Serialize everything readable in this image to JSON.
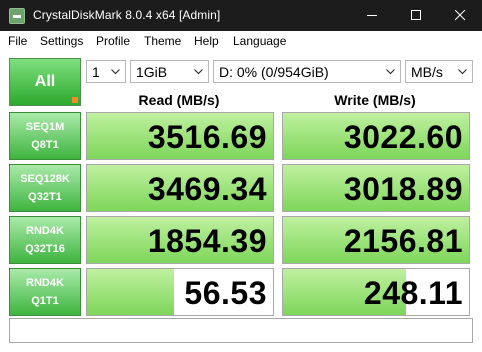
{
  "window": {
    "title": "CrystalDiskMark 8.0.4 x64 [Admin]"
  },
  "menu": [
    "File",
    "Settings",
    "Profile",
    "Theme",
    "Help",
    "Language"
  ],
  "controls": {
    "all_label": "All",
    "count": "1",
    "size": "1GiB",
    "drive": "D: 0% (0/954GiB)",
    "unit": "MB/s"
  },
  "headers": {
    "read": "Read (MB/s)",
    "write": "Write (MB/s)"
  },
  "tests": [
    {
      "line1": "SEQ1M",
      "line2": "Q8T1",
      "read": "3516.69",
      "write": "3022.60",
      "read_fill": 1.0,
      "write_fill": 1.0
    },
    {
      "line1": "SEQ128K",
      "line2": "Q32T1",
      "read": "3469.34",
      "write": "3018.89",
      "read_fill": 1.0,
      "write_fill": 1.0
    },
    {
      "line1": "RND4K",
      "line2": "Q32T16",
      "read": "1854.39",
      "write": "2156.81",
      "read_fill": 1.0,
      "write_fill": 1.0
    },
    {
      "line1": "RND4K",
      "line2": "Q1T1",
      "read": "56.53",
      "write": "248.11",
      "read_fill": 0.47,
      "write_fill": 0.66
    }
  ],
  "colors": {
    "title_bar": "#1c1c1c",
    "button_green": "#3fb43f",
    "bar_green": "#7ed65a"
  },
  "icons": [
    "app-icon",
    "minimize-icon",
    "maximize-icon",
    "close-icon",
    "dropdown-arrow-icon"
  ]
}
